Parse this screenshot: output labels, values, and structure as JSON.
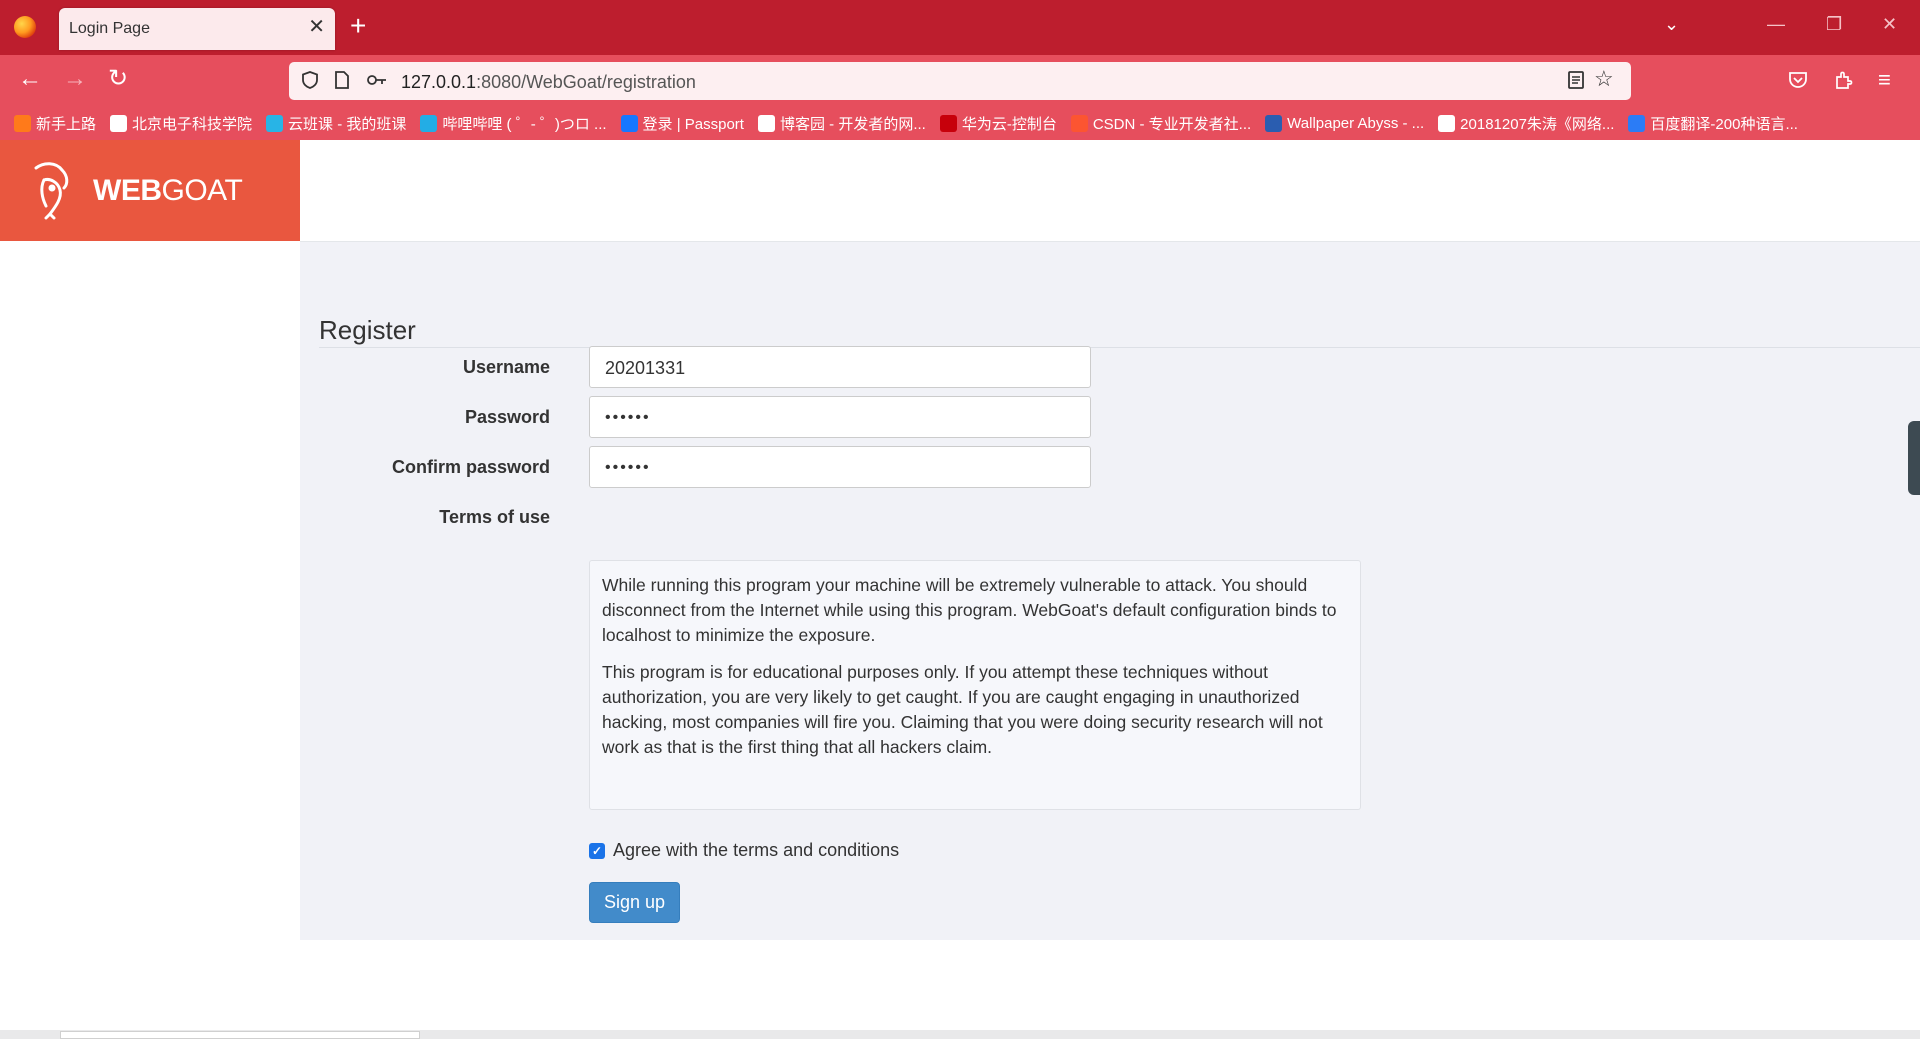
{
  "browser": {
    "tab_title": "Login Page",
    "tab_close": "✕",
    "new_tab": "+",
    "url_host": "127.0.0.1",
    "url_rest": ":8080/WebGoat/registration",
    "bookmarks": [
      {
        "label": "新手上路",
        "color": "#ff7a1a"
      },
      {
        "label": "北京电子科技学院",
        "color": "#ffffff"
      },
      {
        "label": "云班课 - 我的班课",
        "color": "#28b4e6"
      },
      {
        "label": "哔哩哔哩 ( ゜- ゜)つロ ...",
        "color": "#23ade5"
      },
      {
        "label": "登录 | Passport",
        "color": "#1677ff"
      },
      {
        "label": "博客园 - 开发者的网...",
        "color": "#ffffff"
      },
      {
        "label": "华为云-控制台",
        "color": "#c7000b"
      },
      {
        "label": "CSDN - 专业开发者社...",
        "color": "#fc5531"
      },
      {
        "label": "Wallpaper Abyss - ...",
        "color": "#2a5db0"
      },
      {
        "label": "20181207朱涛《网络...",
        "color": "#ffffff"
      },
      {
        "label": "百度翻译-200种语言...",
        "color": "#2b7cf6"
      }
    ]
  },
  "brand": {
    "bold": "WEB",
    "light": "GOAT"
  },
  "form": {
    "title": "Register",
    "username_label": "Username",
    "username_value": "20201331",
    "password_label": "Password",
    "password_value": "••••••",
    "confirm_label": "Confirm password",
    "confirm_value": "••••••",
    "terms_label": "Terms of use",
    "terms_p1": "While running this program your machine will be extremely vulnerable to attack. You should disconnect from the Internet while using this program. WebGoat's default configuration binds to localhost to minimize the exposure.",
    "terms_p2": "This program is for educational purposes only. If you attempt these techniques without authorization, you are very likely to get caught. If you are caught engaging in unauthorized hacking, most companies will fire you. Claiming that you were doing security research will not work as that is the first thing that all hackers claim.",
    "agree_label": "Agree with the terms and conditions",
    "agree_checked": true,
    "signup_label": "Sign up"
  },
  "colors": {
    "tabbar": "#bd1e2e",
    "toolbar": "#e64e5d",
    "brand": "#e9573f",
    "button": "#428bca"
  }
}
